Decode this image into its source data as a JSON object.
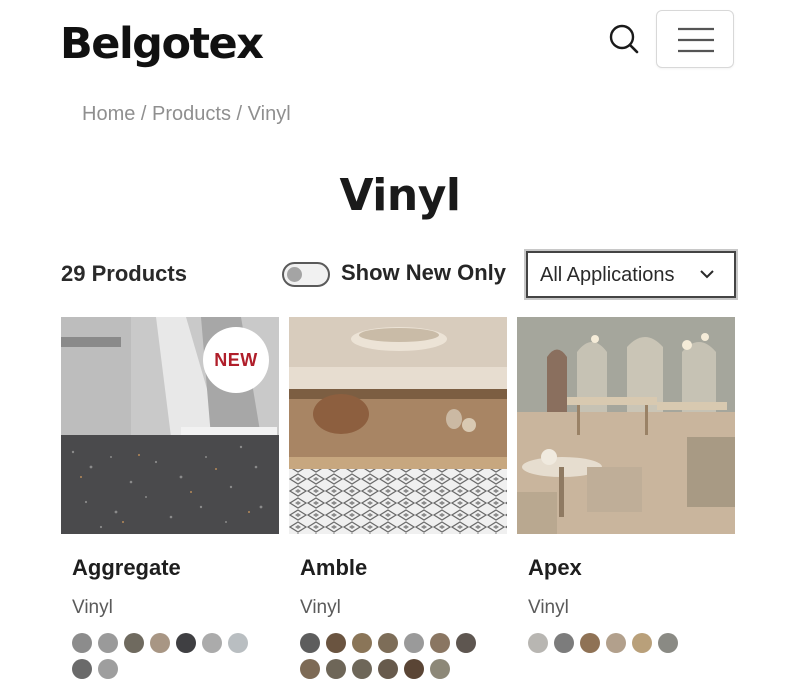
{
  "header": {
    "logo": "Belgotex",
    "search_icon": "search-icon",
    "menu_icon": "hamburger-icon"
  },
  "breadcrumb": {
    "items": [
      "Home",
      "Products",
      "Vinyl"
    ],
    "separator": "/"
  },
  "page": {
    "title": "Vinyl",
    "product_count": "29 Products",
    "toggle_label": "Show New Only",
    "toggle_on": false,
    "filter_value": "All Applications",
    "filter_icon": "chevron-down-icon"
  },
  "colors": {
    "badge_text": "#b01e2a",
    "muted_text": "#8f8f8f"
  },
  "products": [
    {
      "name": "Aggregate",
      "type": "Vinyl",
      "badge": "NEW",
      "swatches": [
        "#8c8c8c",
        "#9a9a9a",
        "#6f6a5f",
        "#a89684",
        "#3f3f42",
        "#ababab",
        "#b9bec1",
        "#6a6a6a",
        "#9e9e9e"
      ]
    },
    {
      "name": "Amble",
      "type": "Vinyl",
      "swatches": [
        "#5d5d5d",
        "#6a5440",
        "#8a7558",
        "#7d6d58",
        "#9a9a9a",
        "#8a7662",
        "#5e5650",
        "#7d6a55",
        "#6e6658",
        "#6e6759",
        "#675a4c",
        "#5a4535",
        "#8d8878"
      ]
    },
    {
      "name": "Apex",
      "type": "Vinyl",
      "swatches": [
        "#b8b6b2",
        "#7c7c7c",
        "#8f7255",
        "#b2a08c",
        "#b9a07a",
        "#8a8a84"
      ]
    }
  ]
}
